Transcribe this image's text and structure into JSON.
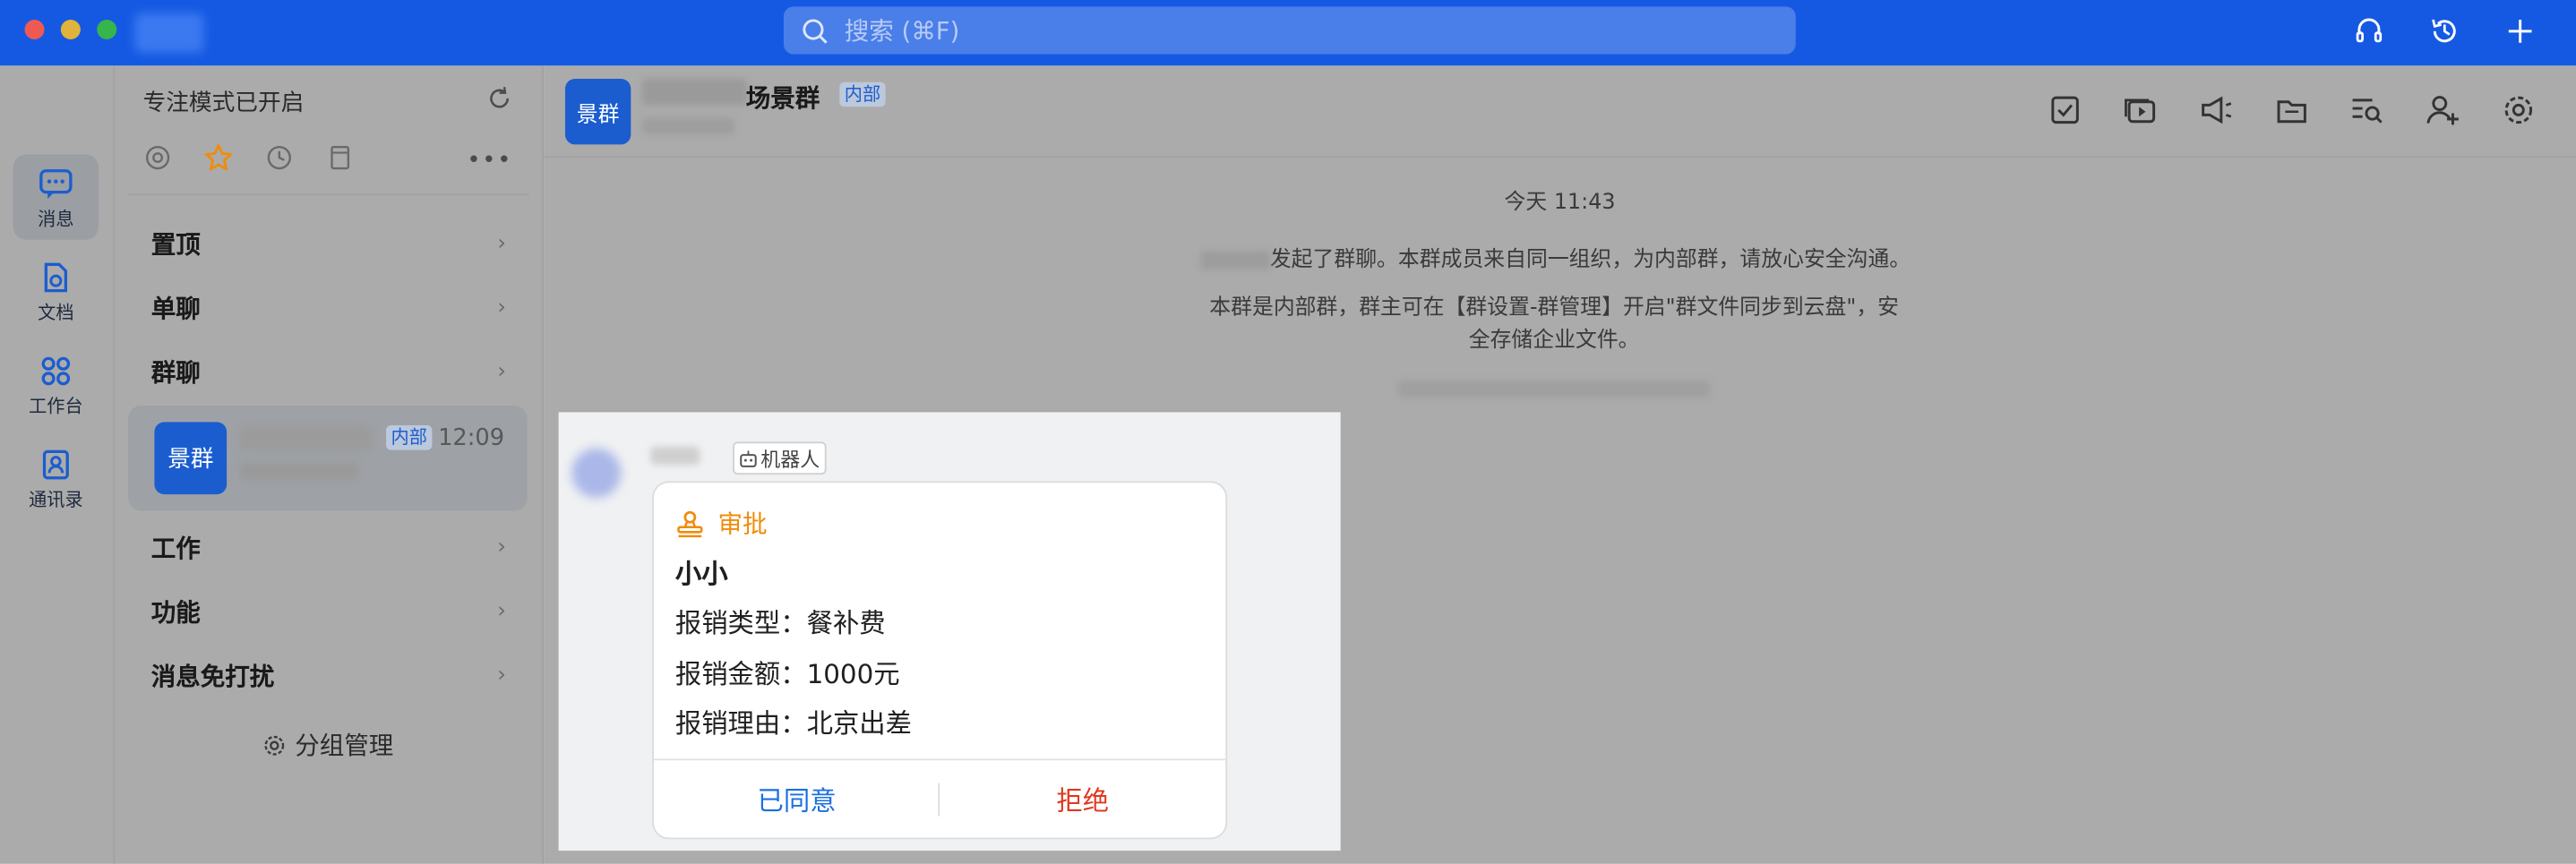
{
  "search": {
    "placeholder": "搜索 (⌘F)"
  },
  "rail": {
    "items": [
      {
        "label": "消息",
        "icon": "chat-bubble-icon"
      },
      {
        "label": "文档",
        "icon": "document-icon"
      },
      {
        "label": "工作台",
        "icon": "grid-apps-icon"
      },
      {
        "label": "通讯录",
        "icon": "contacts-icon"
      }
    ]
  },
  "sidebar": {
    "header": "专注模式已开启",
    "rows": [
      "置顶",
      "单聊",
      "群聊",
      "工作",
      "功能",
      "消息免打扰"
    ],
    "chat": {
      "avatar_text": "景群",
      "badge": "内部",
      "time": "12:09"
    },
    "group_manage": "分组管理"
  },
  "main": {
    "header": {
      "avatar_text": "景群",
      "name_suffix": "场景群",
      "badge": "内部"
    },
    "timestamp": "今天 11:43",
    "system_msg_1": "发起了群聊。本群成员来自同一组织，为内部群，请放心安全沟通。",
    "system_msg_2": "本群是内部群，群主可在【群设置-群管理】开启\"群文件同步到云盘\"，安全存储企业文件。"
  },
  "message": {
    "bot_tag": "机器人",
    "card": {
      "title": "审批",
      "name": "小小",
      "line1": "报销类型：餐补费",
      "line2": "报销金额：1000元",
      "line3": "报销理由：北京出差",
      "agree": "已同意",
      "reject": "拒绝"
    }
  },
  "colors": {
    "brand": "#1559e3",
    "approval": "#f08c0a",
    "agree": "#1b6fe0",
    "reject": "#e0381f"
  }
}
